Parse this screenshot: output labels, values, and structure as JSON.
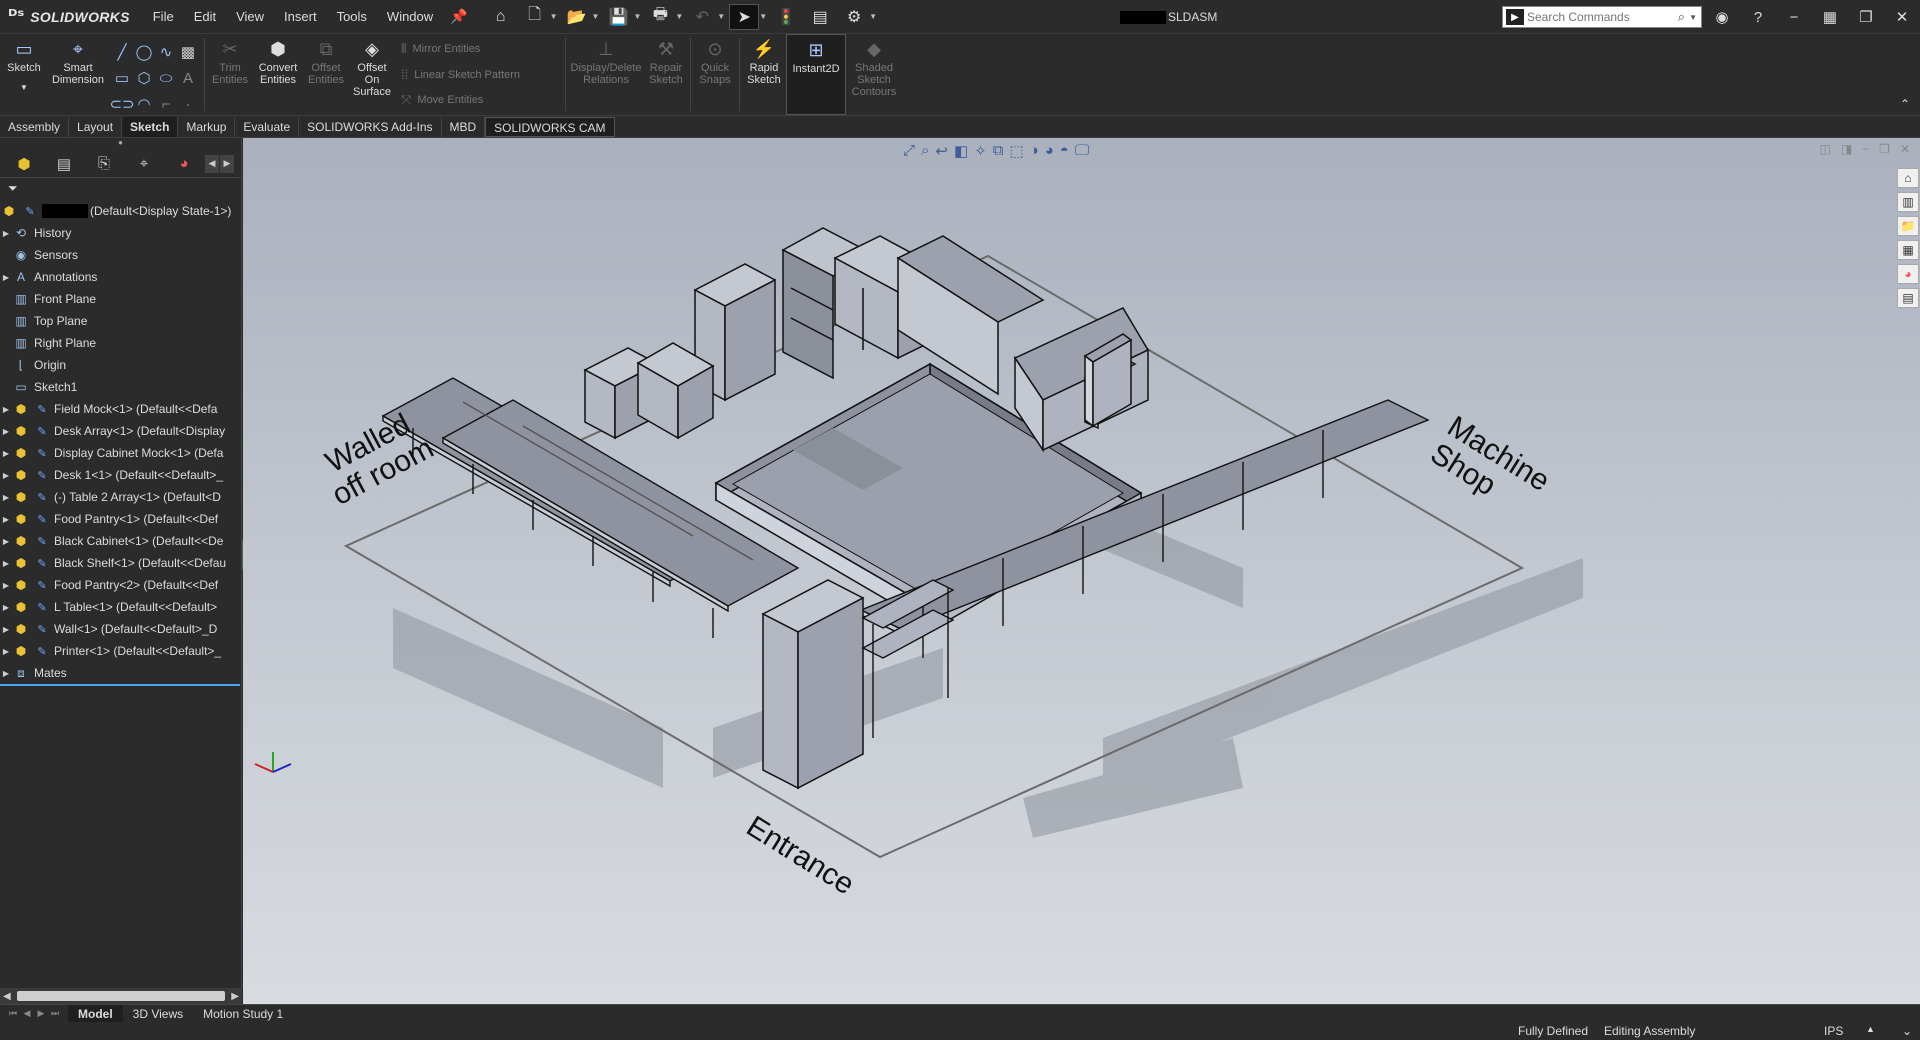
{
  "app": {
    "name": "SOLIDWORKS",
    "doc_suffix": "SLDASM"
  },
  "menu": [
    "File",
    "Edit",
    "View",
    "Insert",
    "Tools",
    "Window"
  ],
  "search": {
    "placeholder": "Search Commands"
  },
  "ribbon": {
    "sketch": "Sketch",
    "smart_dimension": [
      "Smart",
      "Dimension"
    ],
    "trim": [
      "Trim",
      "Entities"
    ],
    "convert": [
      "Convert",
      "Entities"
    ],
    "offset": [
      "Offset",
      "Entities"
    ],
    "offset_surface": [
      "Offset",
      "On",
      "Surface"
    ],
    "mirror": "Mirror Entities",
    "linear_pattern": "Linear Sketch Pattern",
    "move": "Move Entities",
    "display_delete": [
      "Display/Delete",
      "Relations"
    ],
    "repair": [
      "Repair",
      "Sketch"
    ],
    "quick_snaps": [
      "Quick",
      "Snaps"
    ],
    "rapid": [
      "Rapid",
      "Sketch"
    ],
    "instant2d": "Instant2D",
    "shaded": [
      "Shaded",
      "Sketch",
      "Contours"
    ]
  },
  "tabs": [
    "Assembly",
    "Layout",
    "Sketch",
    "Markup",
    "Evaluate",
    "SOLIDWORKS Add-Ins",
    "MBD",
    "SOLIDWORKS CAM"
  ],
  "tree": {
    "root": "(Default<Display State-1>)",
    "items": [
      {
        "label": "History",
        "icon": "history-icon",
        "expand": true
      },
      {
        "label": "Sensors",
        "icon": "sensors-icon",
        "expand": false
      },
      {
        "label": "Annotations",
        "icon": "annotations-icon",
        "expand": true
      },
      {
        "label": "Front Plane",
        "icon": "plane-icon",
        "expand": false
      },
      {
        "label": "Top Plane",
        "icon": "plane-icon",
        "expand": false
      },
      {
        "label": "Right Plane",
        "icon": "plane-icon",
        "expand": false
      },
      {
        "label": "Origin",
        "icon": "origin-icon",
        "expand": false
      },
      {
        "label": "Sketch1",
        "icon": "sketch-icon",
        "expand": false
      }
    ],
    "components": [
      "Field Mock<1> (Default<<Defa",
      "Desk Array<1> (Default<Display",
      "Display Cabinet Mock<1> (Defa",
      "Desk 1<1> (Default<<Default>_",
      "(-) Table 2 Array<1> (Default<D",
      "Food Pantry<1> (Default<<Def",
      "Black Cabinet<1> (Default<<De",
      "Black Shelf<1> (Default<<Defau",
      "Food Pantry<2> (Default<<Def",
      "L Table<1> (Default<<Default>",
      "Wall<1> (Default<<Default>_D",
      "Printer<1> (Default<<Default>_"
    ],
    "mates": "Mates"
  },
  "viewport_labels": {
    "walled": [
      "Walled",
      "off room"
    ],
    "machine": [
      "Machine",
      "Shop"
    ],
    "entrance": "Entrance"
  },
  "bottom_tabs": [
    "Model",
    "3D Views",
    "Motion Study 1"
  ],
  "status": {
    "defined": "Fully Defined",
    "mode": "Editing Assembly",
    "units": "IPS"
  }
}
